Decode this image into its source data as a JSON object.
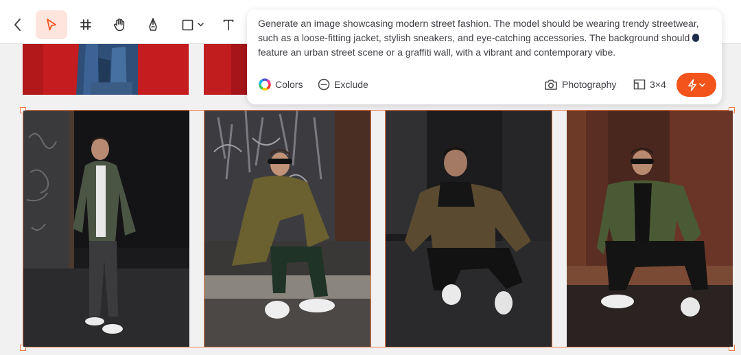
{
  "toolbar": {
    "tools": [
      {
        "id": "back",
        "icon": "chevron-left-icon"
      },
      {
        "id": "select",
        "icon": "pointer-icon",
        "active": true
      },
      {
        "id": "frame",
        "icon": "hash-icon"
      },
      {
        "id": "hand",
        "icon": "hand-icon"
      },
      {
        "id": "pen",
        "icon": "pen-icon"
      },
      {
        "id": "shape",
        "icon": "square-icon"
      },
      {
        "id": "text",
        "icon": "text-icon"
      }
    ]
  },
  "prompt": {
    "lines": [
      "Generate an image showcasing modern street fashion. The model should be wearing trendy streetwear,",
      "such as a loose-fitting jacket, stylish sneakers, and eye-catching accessories. The background should",
      "feature an urban street scene or a graffiti wall, with a vibrant and contemporary vibe."
    ],
    "colors_label": "Colors",
    "exclude_label": "Exclude",
    "style_label": "Photography",
    "ratio_label": "3×4"
  },
  "colors": {
    "accent": "#f2541b",
    "selection": "#f07a4a",
    "active_tool_bg": "#fde4dc"
  },
  "images": [
    {
      "id": "photo-1",
      "subject": "standing man in olive jacket near graffiti wall"
    },
    {
      "id": "photo-2",
      "subject": "man with sunglasses sitting on curb in olive jacket"
    },
    {
      "id": "photo-3",
      "subject": "man crouching in olive jacket in dark alley"
    },
    {
      "id": "photo-4",
      "subject": "man with sunglasses crouching in olive jacket against red wall"
    }
  ]
}
